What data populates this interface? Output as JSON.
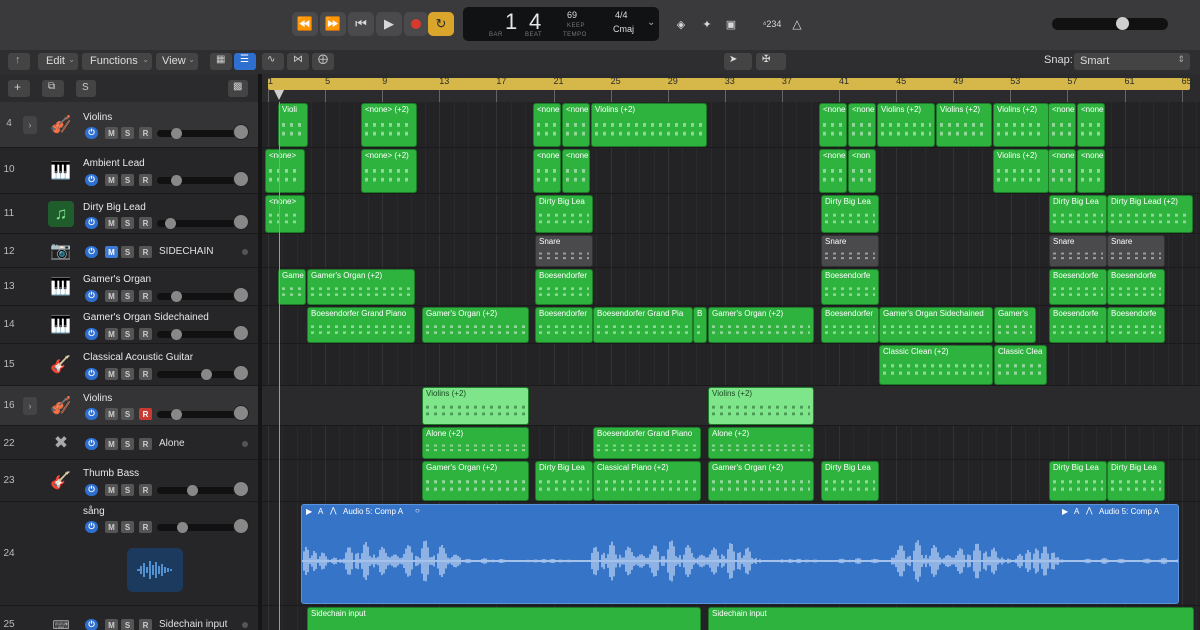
{
  "transport": {
    "lcd": {
      "bar": "1",
      "beat": "4",
      "bar_label": "BAR",
      "beat_label": "BEAT",
      "tempo": "69",
      "tempo_mode": "KEEP",
      "tempo_label": "TEMPO",
      "signature": "4/4",
      "key": "Cmaj"
    },
    "count_in_label": "⁴234"
  },
  "menubar": {
    "edit": "Edit",
    "functions": "Functions",
    "view": "View",
    "snap_label": "Snap:",
    "snap_value": "Smart"
  },
  "ruler": {
    "bars": [
      "1",
      "5",
      "9",
      "13",
      "17",
      "21",
      "25",
      "29",
      "33",
      "37",
      "41",
      "45",
      "49",
      "53",
      "57",
      "61",
      "65"
    ]
  },
  "tracks": [
    {
      "number": "4",
      "name": "Violins",
      "icon": "violin-icon",
      "disclosure": true,
      "mute": false,
      "solo": false,
      "record": false
    },
    {
      "number": "10",
      "name": "Ambient Lead",
      "icon": "synth-keyboard-icon",
      "mute": false,
      "solo": false,
      "record": false
    },
    {
      "number": "11",
      "name": "Dirty Big Lead",
      "icon": "music-note-icon",
      "mute": false,
      "solo": false,
      "record": false
    },
    {
      "number": "12",
      "name": "SIDECHAIN",
      "icon": "sidechain-icon",
      "mute": true,
      "solo": false,
      "record": false
    },
    {
      "number": "13",
      "name": "Gamer's Organ",
      "icon": "organ-icon",
      "mute": false,
      "solo": false,
      "record": false
    },
    {
      "number": "14",
      "name": "Gamer's Organ Sidechained",
      "icon": "organ-icon",
      "mute": false,
      "solo": false,
      "record": false
    },
    {
      "number": "15",
      "name": "Classical Acoustic Guitar",
      "icon": "guitar-icon",
      "mute": false,
      "solo": false,
      "record": false
    },
    {
      "number": "16",
      "name": "Violins",
      "icon": "violin-icon",
      "disclosure": true,
      "mute": false,
      "solo": false,
      "record": true
    },
    {
      "number": "22",
      "name": "Alone",
      "icon": "drum-stand-icon",
      "mute": false,
      "solo": false,
      "record": false
    },
    {
      "number": "23",
      "name": "Thumb Bass",
      "icon": "bass-guitar-icon",
      "mute": false,
      "solo": false,
      "record": false
    },
    {
      "number": "24",
      "name": "sång",
      "icon": "waveform-icon",
      "mute": false,
      "solo": false,
      "record": false
    },
    {
      "number": "25",
      "name": "Sidechain input",
      "icon": "keyboard-icon",
      "mute": false,
      "solo": false,
      "record": false
    }
  ],
  "regions": {
    "t4": [
      "Violi",
      "<none> (+2)",
      "<none",
      "<none",
      "Violins (+2)",
      "<none",
      "<none",
      "Violins (+2)",
      "Violins (+2)",
      "Violins (+2)",
      "<none",
      "<none"
    ],
    "t10": [
      "<none>",
      "<none> (+2)",
      "<none",
      "<none",
      "<none",
      "<non",
      "Violins (+2)",
      "<none",
      "<none"
    ],
    "t11": [
      "<none>",
      "Dirty Big Lea",
      "Dirty Big Lea",
      "Dirty Big Lea",
      "Dirty Big Lead (+2)"
    ],
    "t12": [
      "Snare",
      "Snare",
      "Snare",
      "Snare"
    ],
    "t13": [
      "Game",
      "Gamer's Organ (+2)",
      "Boesendorfer",
      "Boesendorfe",
      "Boesendorfe",
      "Boesendorfe"
    ],
    "t14": [
      "Boesendorfer Grand Piano",
      "Gamer's Organ (+2)",
      "Boesendorfer",
      "Boesendorfer Grand Pia",
      "B",
      "Gamer's Organ (+2)",
      "Boesendorfer",
      "Gamer's Organ Sidechained",
      "Gamer's",
      "Boesendorfe",
      "Boesendorfe"
    ],
    "t15": [
      "Classic Clean (+2)",
      "Classic Clea"
    ],
    "t16": [
      "Violins (+2)",
      "Violins (+2)"
    ],
    "t22": [
      "Alone (+2)",
      "Boesendorfer Grand Piano",
      "Alone (+2)"
    ],
    "t23": [
      "Gamer's Organ (+2)",
      "Dirty Big Lea",
      "Classical Piano (+2)",
      "Gamer's Organ (+2)",
      "Dirty Big Lea",
      "Dirty Big Lea",
      "Dirty Big Lea"
    ],
    "t24": [
      "Audio 5: Comp A",
      "Audio 5: Comp A"
    ],
    "t25": [
      "Sidechain input",
      "Sidechain input"
    ]
  },
  "colors": {
    "midi_region": "#2fb33f",
    "audio_region": "#3674c8",
    "ruler_cycle": "#d6b84a",
    "record": "#d83a2e",
    "cycle_button": "#d9a62b",
    "power": "#2f6fd0"
  }
}
